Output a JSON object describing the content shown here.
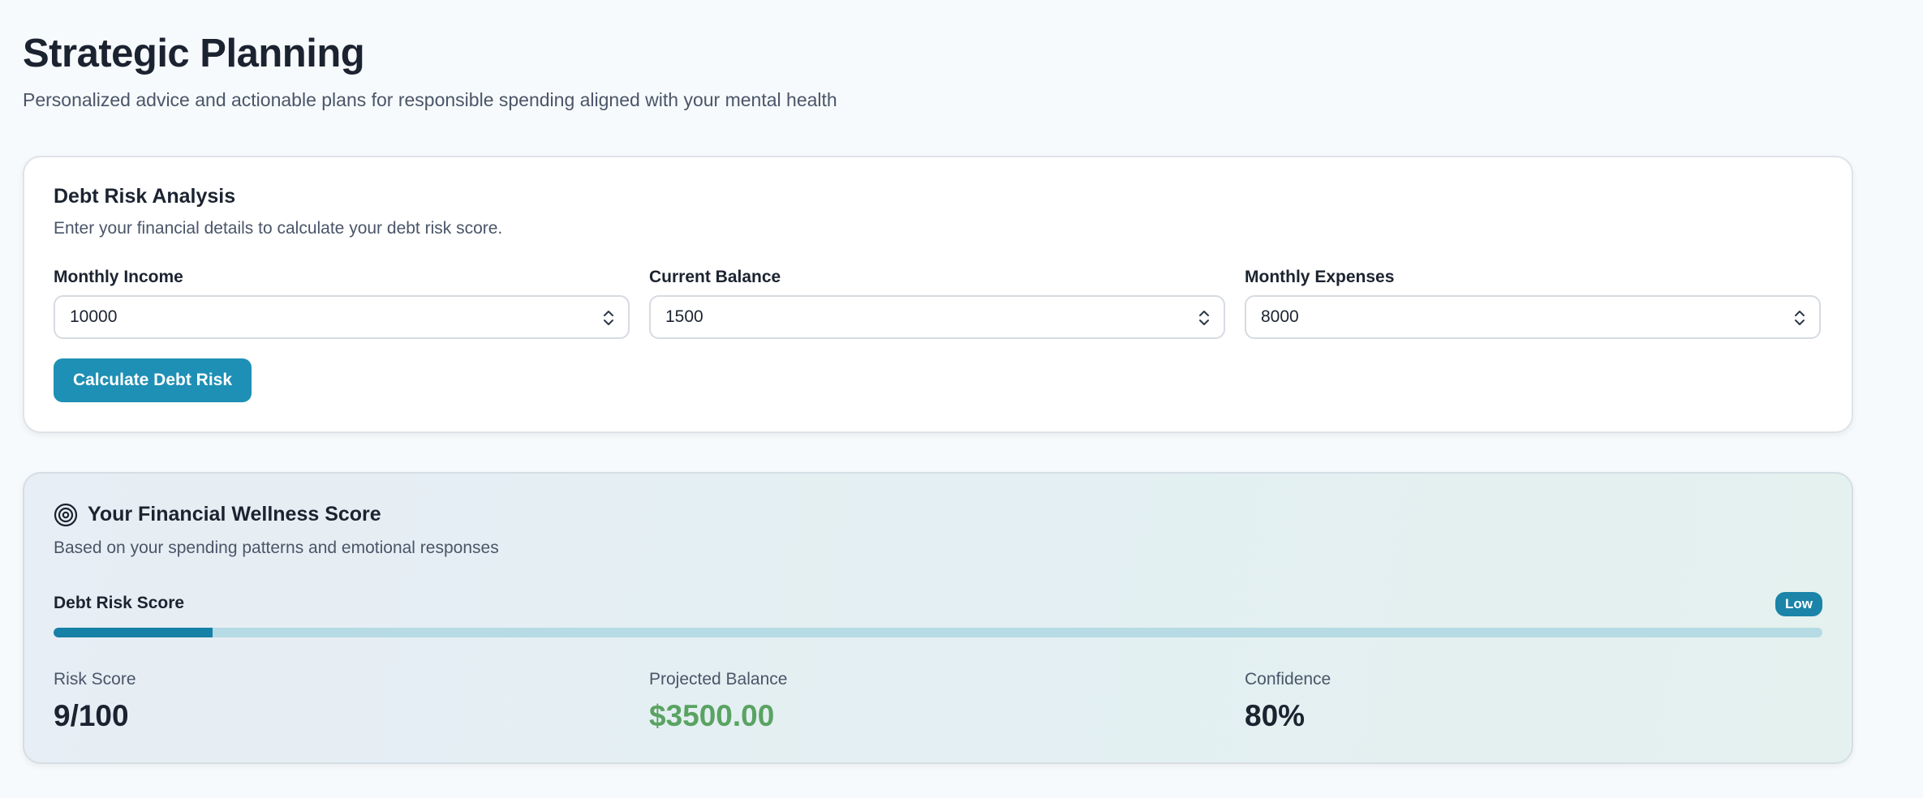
{
  "header": {
    "title": "Strategic Planning",
    "subtitle": "Personalized advice and actionable plans for responsible spending aligned with your mental health"
  },
  "debt_analysis": {
    "title": "Debt Risk Analysis",
    "description": "Enter your financial details to calculate your debt risk score.",
    "fields": [
      {
        "label": "Monthly Income",
        "value": "10000"
      },
      {
        "label": "Current Balance",
        "value": "1500"
      },
      {
        "label": "Monthly Expenses",
        "value": "8000"
      }
    ],
    "button_label": "Calculate Debt Risk",
    "accent_color": "#1e8fb5"
  },
  "wellness": {
    "icon": "target-icon",
    "title": "Your Financial Wellness Score",
    "description": "Based on your spending patterns and emotional responses",
    "risk_label": "Debt Risk Score",
    "risk_badge": "Low",
    "risk_progress_percent": 9,
    "stats": [
      {
        "label": "Risk Score",
        "value": "9/100",
        "color": "#1c2330"
      },
      {
        "label": "Projected Balance",
        "value": "$3500.00",
        "color": "#5aa362"
      },
      {
        "label": "Confidence",
        "value": "80%",
        "color": "#1c2330"
      }
    ]
  }
}
